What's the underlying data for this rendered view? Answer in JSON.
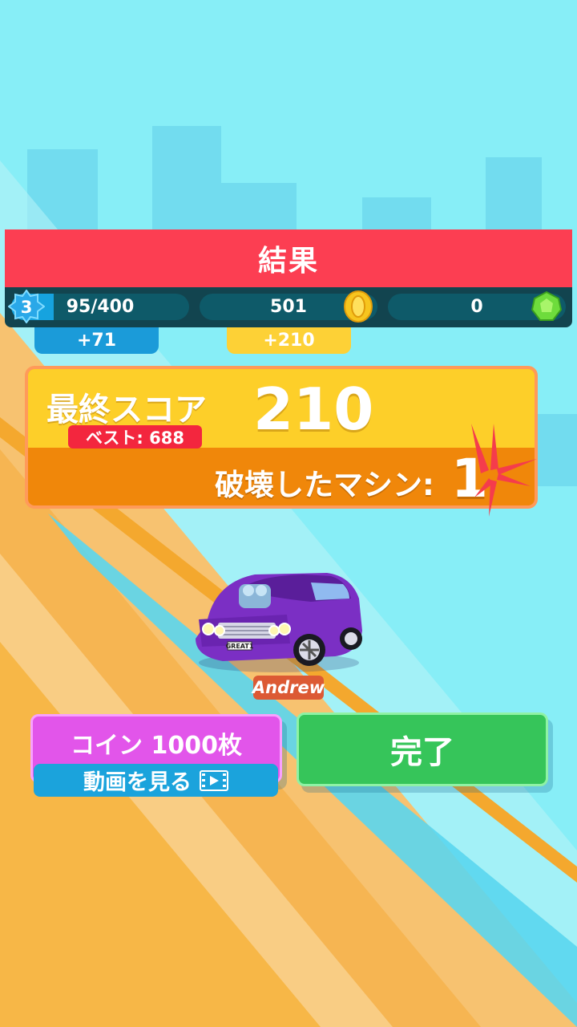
{
  "title": "結果",
  "stats": {
    "level": "3",
    "xp": "95/400",
    "xp_progress": 0.2375,
    "coins": "501",
    "gems": "0"
  },
  "gains": {
    "xp": "+71",
    "coins": "+210"
  },
  "score": {
    "label": "最終スコア",
    "value": "210",
    "best": "ベスト: 688",
    "destroyed_label": "破壊したマシン:",
    "destroyed_value": "1"
  },
  "car": {
    "plate": "GREAT1",
    "player_name": "Andrew"
  },
  "buttons": {
    "ad_label": "コイン 1000枚",
    "ad_sub_label": "動画を見る",
    "done_label": "完了"
  },
  "icons": {
    "level": "level-star-badge-icon",
    "coin": "coin-icon",
    "gem": "gem-icon",
    "video": "film-icon"
  },
  "colors": {
    "title_bar": "#fc3e52",
    "score_top": "#fdcf29",
    "score_bottom": "#f0870a",
    "ad_button": "#e255ea",
    "done_button": "#36c55a"
  }
}
